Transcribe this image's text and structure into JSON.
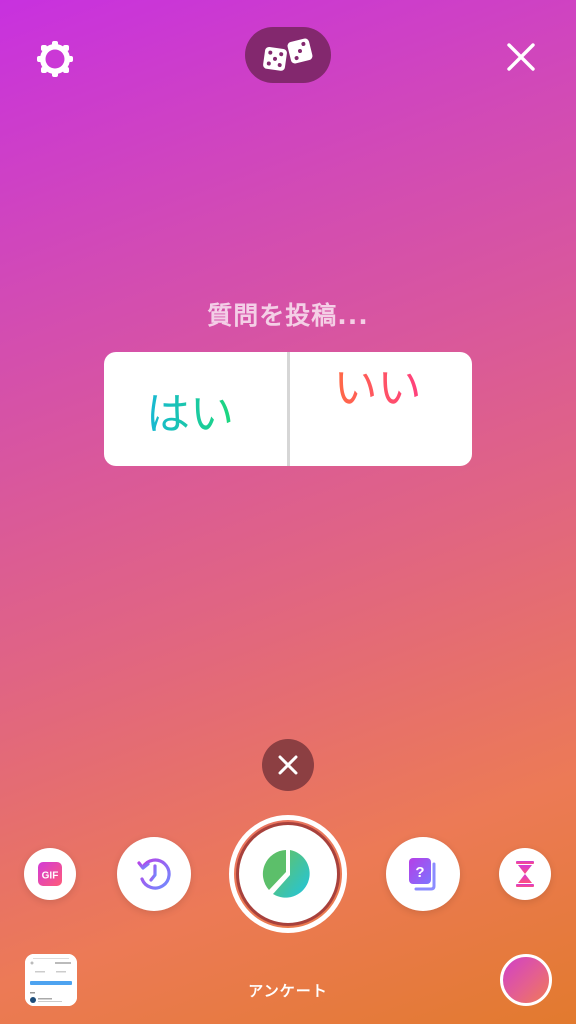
{
  "top_bar": {
    "settings_icon": "gear-icon",
    "dice_icon": "dice-icon",
    "close_icon": "close-icon"
  },
  "poll": {
    "question_placeholder": "質問を投稿...",
    "option_yes": "はい",
    "option_no": "いい"
  },
  "sticker_tray": {
    "dismiss_icon": "close-icon",
    "items": [
      {
        "name": "gif",
        "label": "GIF",
        "icon": "gif-icon"
      },
      {
        "name": "history",
        "icon": "history-icon"
      },
      {
        "name": "poll",
        "icon": "pie-chart-icon",
        "selected": true
      },
      {
        "name": "question",
        "label": "?",
        "icon": "question-cards-icon"
      },
      {
        "name": "countdown",
        "icon": "hourglass-icon"
      }
    ],
    "mode_label": "アンケート"
  },
  "colors": {
    "gradient_start": "#c831df",
    "gradient_end": "#e27a2e",
    "dice_pill": "#83286e",
    "dismiss_bg": "#8c3f42",
    "poll_ring": "#a8413c"
  }
}
